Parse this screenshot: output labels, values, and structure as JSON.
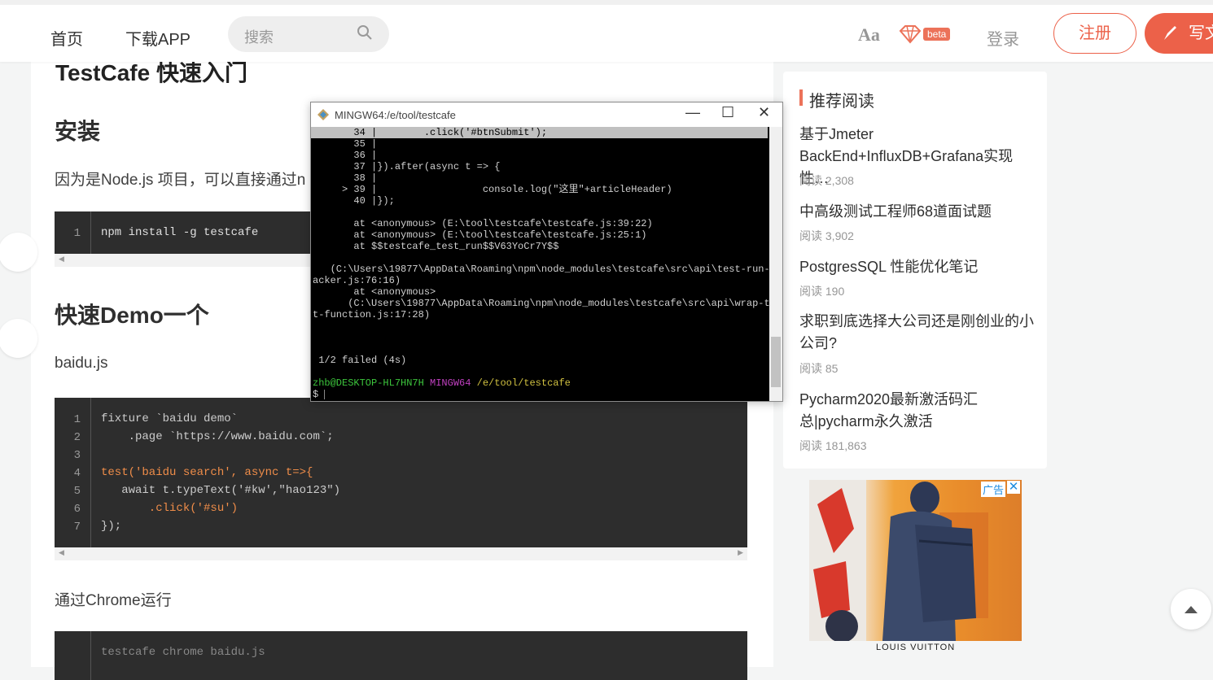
{
  "header": {
    "nav": [
      "首页",
      "下载APP"
    ],
    "search_placeholder": "搜索",
    "font_label": "Aa",
    "beta_label": "beta",
    "login_label": "登录",
    "register_label": "注册",
    "write_label": "写文"
  },
  "article": {
    "title": "TestCafe 快速入门",
    "h_install": "安装",
    "p_install": "因为是Node.js 项目，可以直接通过n",
    "code1": {
      "line_numbers": [
        "1"
      ],
      "lines": [
        "npm install -g testcafe"
      ]
    },
    "h_demo": "快速Demo一个",
    "p_file": "baidu.js",
    "code2": {
      "line_numbers": [
        "1",
        "2",
        "3",
        "4",
        "5",
        "6",
        "7"
      ],
      "lines": [
        "fixture `baidu demo`",
        "    .page `https://www.baidu.com`;",
        "",
        "test('baidu search', async t=>{",
        "   await t.typeText('#kw',\"hao123\")",
        "       .click('#su')",
        "});"
      ]
    },
    "p_chrome": "通过Chrome运行",
    "code3_partial": "testcafe chrome baidu.js"
  },
  "terminal": {
    "title": "MINGW64:/e/tool/testcafe",
    "min": "—",
    "max": "☐",
    "close": "✕",
    "lines": [
      "       34 |        .click('#btnSubmit');",
      "       35 |",
      "       36 |",
      "       37 |}).after(async t => {",
      "       38 |",
      "     > 39 |                  console.log(\"这里\"+articleHeader)",
      "       40 |});",
      "",
      "       at <anonymous> (E:\\tool\\testcafe\\testcafe.js:39:22)",
      "       at <anonymous> (E:\\tool\\testcafe\\testcafe.js:25:1)",
      "       at $$testcafe_test_run$$V63YoCr7Y$$",
      "",
      "   (C:\\Users\\19877\\AppData\\Roaming\\npm\\node_modules\\testcafe\\src\\api\\test-run-tr",
      "acker.js:76:16)",
      "       at <anonymous>",
      "      (C:\\Users\\19877\\AppData\\Roaming\\npm\\node_modules\\testcafe\\src\\api\\wrap-tes",
      "t-function.js:17:28)",
      "",
      "",
      "",
      " 1/2 failed (4s)",
      ""
    ],
    "prompt_user": "zhb@DESKTOP-HL7HN7H",
    "prompt_env": "MINGW64",
    "prompt_path": "/e/tool/testcafe",
    "prompt_symbol": "$"
  },
  "sidebar": {
    "title": "推荐阅读",
    "items": [
      {
        "title": "基于Jmeter BackEnd+InfluxDB+Grafana实现性…",
        "meta": "阅读 2,308"
      },
      {
        "title": "中高级测试工程师68道面试题",
        "meta": "阅读 3,902"
      },
      {
        "title": "PostgresSQL 性能优化笔记",
        "meta": "阅读 190"
      },
      {
        "title": "求职到底选择大公司还是刚创业的小公司?",
        "meta": "阅读 85"
      },
      {
        "title": "Pycharm2020最新激活码汇总|pycharm永久激活",
        "meta": "阅读 181,863"
      }
    ]
  },
  "ad": {
    "tag": "广告",
    "close": "✕",
    "caption": "LOUIS VUITTON"
  },
  "colors": {
    "accent": "#ec6149",
    "code_bg": "#2d2d2d",
    "terminal_bg": "#000000"
  }
}
